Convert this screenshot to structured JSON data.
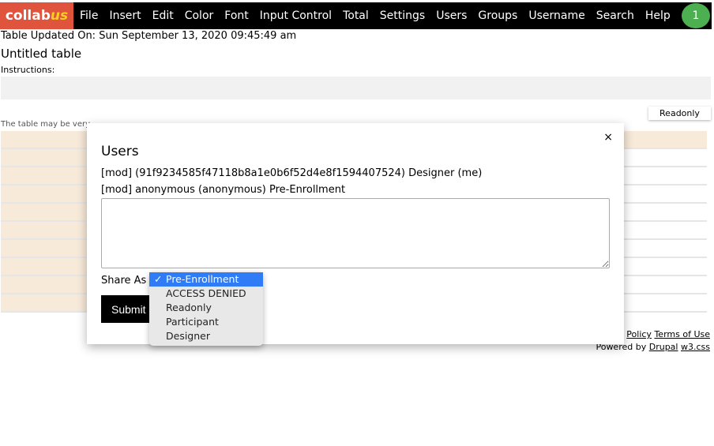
{
  "nav": {
    "logo": "collab",
    "logo_accent": "us",
    "items": [
      "File",
      "Insert",
      "Edit",
      "Color",
      "Font",
      "Input Control",
      "Total",
      "Settings",
      "Users",
      "Groups",
      "Username",
      "Search",
      "Help"
    ],
    "badge": "1"
  },
  "page": {
    "updated": "Table Updated On: Sun September 13, 2020 09:45:49 am",
    "title": "Untitled table",
    "instructions_label": "Instructions:",
    "mode_button": "Readonly",
    "warning": "The table may be very"
  },
  "footer": {
    "policy": "Policy",
    "terms": "Terms of Use",
    "powered": "Powered by",
    "drupal": "Drupal",
    "w3": "w3.css"
  },
  "modal": {
    "title": "Users",
    "close": "×",
    "users": [
      "[mod] (91f9234585f47118b8a1e0b6f52d4e8f1594407524) Designer (me)",
      "[mod] anonymous (anonymous) Pre-Enrollment"
    ],
    "textarea_value": "",
    "share_label": "Share As",
    "submit": "Submit"
  },
  "dropdown": {
    "selected": "Pre-Enrollment",
    "check": "✓",
    "options": [
      "Pre-Enrollment",
      "ACCESS DENIED",
      "Readonly",
      "Participant",
      "Designer"
    ]
  },
  "colors": {
    "logo_bg": "#e0533d",
    "badge": "#4caf50",
    "row_highlight": "#f8ead9",
    "selected_option": "#2f7cf6"
  }
}
